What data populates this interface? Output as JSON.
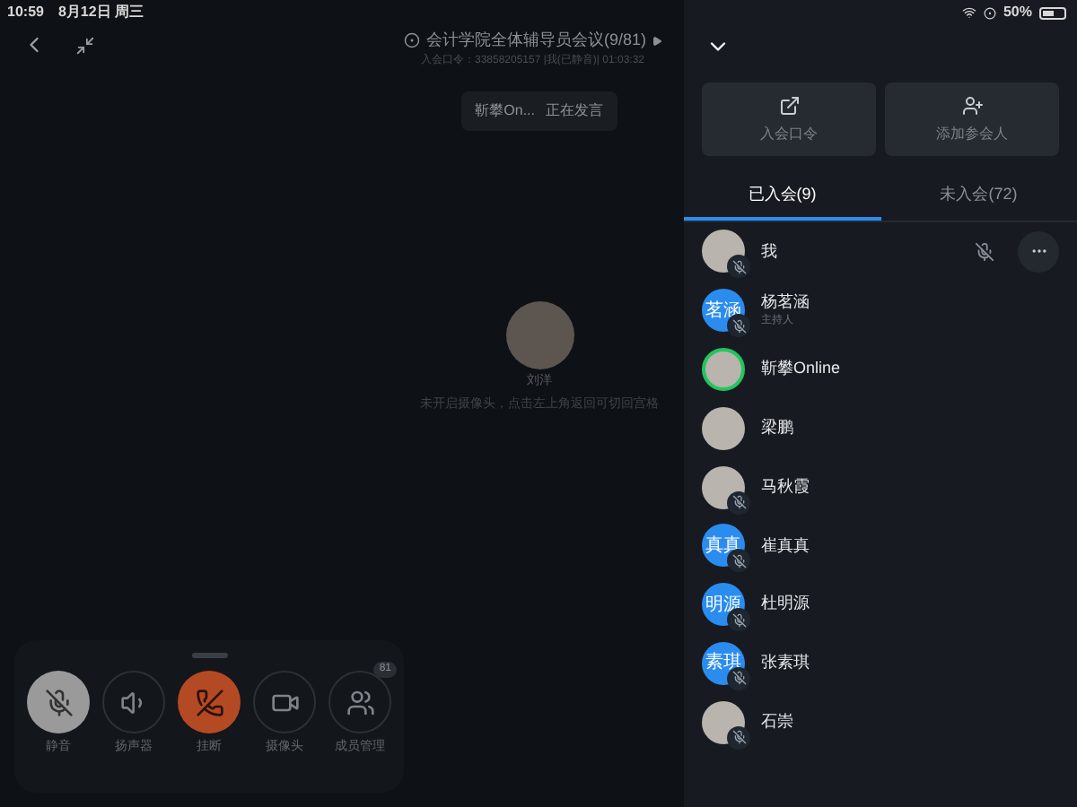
{
  "status_bar": {
    "time": "10:59",
    "date": "8月12日 周三",
    "battery": "50%"
  },
  "meeting": {
    "title": "会计学院全体辅导员会议(9/81)",
    "info": "入会口令：33858205157 |我(已静音)| 01:03:32",
    "speaking_toast": {
      "name": "靳攀On...",
      "status": "正在发言"
    }
  },
  "center_video": {
    "name": "刘洋",
    "hint": "未开启摄像头，点击左上角返回可切回宫格"
  },
  "controls": [
    {
      "kind": "mute",
      "label": "静音",
      "active": true
    },
    {
      "kind": "speaker",
      "label": "扬声器",
      "active": false
    },
    {
      "kind": "hangup",
      "label": "挂断",
      "active": false
    },
    {
      "kind": "camera",
      "label": "摄像头",
      "active": false
    },
    {
      "kind": "members",
      "label": "成员管理",
      "active": false,
      "badge": "81"
    }
  ],
  "panel": {
    "actions": [
      {
        "kind": "share",
        "label": "入会口令"
      },
      {
        "kind": "add-person",
        "label": "添加参会人"
      }
    ],
    "tabs": [
      {
        "label": "已入会(9)",
        "selected": true
      },
      {
        "label": "未入会(72)",
        "selected": false
      }
    ],
    "participants": [
      {
        "name": "我",
        "avatar": {
          "kind": "photo"
        },
        "muted": true,
        "speaking": false,
        "self": true
      },
      {
        "name": "杨茗涵",
        "role": "主持人",
        "avatar": {
          "kind": "initials",
          "text": "茗涵"
        },
        "muted": true,
        "speaking": false
      },
      {
        "name": "靳攀Online",
        "avatar": {
          "kind": "photo"
        },
        "muted": false,
        "speaking": true
      },
      {
        "name": "梁鹏",
        "avatar": {
          "kind": "photo"
        },
        "muted": false,
        "speaking": false
      },
      {
        "name": "马秋霞",
        "avatar": {
          "kind": "photo"
        },
        "muted": true,
        "speaking": false
      },
      {
        "name": "崔真真",
        "avatar": {
          "kind": "initials",
          "text": "真真"
        },
        "muted": true,
        "speaking": false
      },
      {
        "name": "杜明源",
        "avatar": {
          "kind": "initials",
          "text": "明源"
        },
        "muted": true,
        "speaking": false
      },
      {
        "name": "张素琪",
        "avatar": {
          "kind": "initials",
          "text": "素琪"
        },
        "muted": true,
        "speaking": false
      },
      {
        "name": "石崇",
        "avatar": {
          "kind": "photo"
        },
        "muted": true,
        "speaking": false
      }
    ]
  }
}
